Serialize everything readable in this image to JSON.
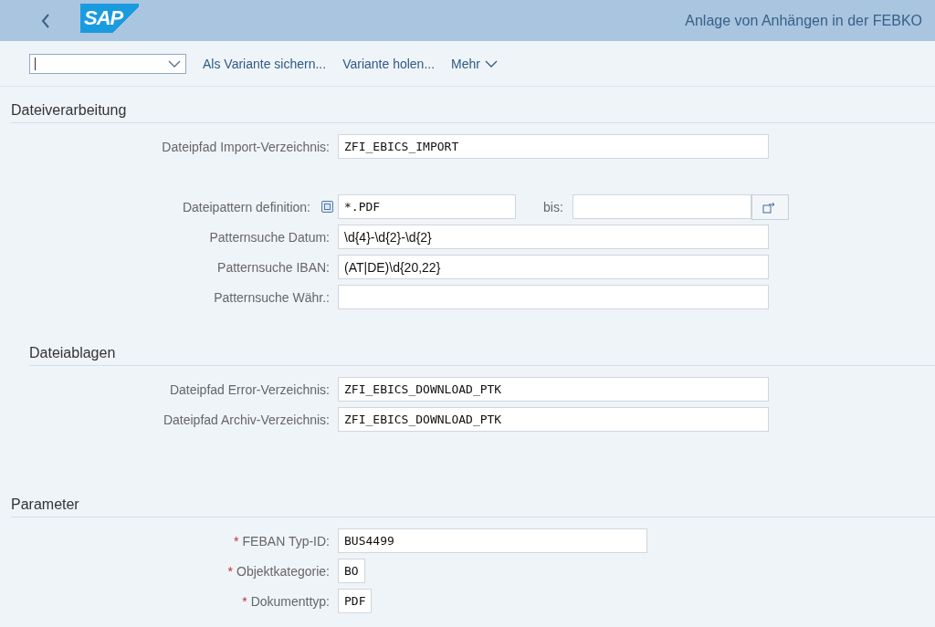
{
  "header": {
    "logo": "SAP",
    "title": "Anlage von Anhängen in der FEBKO"
  },
  "toolbar": {
    "actions": [
      {
        "label": "Als Variante sichern...",
        "kind": "link"
      },
      {
        "label": "Variante holen...",
        "kind": "link"
      },
      {
        "label": "Mehr",
        "kind": "menu"
      }
    ]
  },
  "sections": [
    {
      "title": "Dateiverarbeitung",
      "kind": "main",
      "groups": [
        [
          {
            "label": "Dateipfad Import-Verzeichnis:",
            "value": "ZFI_EBICS_IMPORT",
            "kind": "path"
          }
        ],
        [
          {
            "label": "Dateipattern definition:",
            "value": "*.PDF",
            "kind": "range",
            "to_label": "bis:"
          },
          {
            "label": "Patternsuche Datum:",
            "value": "\\d{4}-\\d{2}-\\d{2}",
            "kind": "pattern"
          },
          {
            "label": "Patternsuche IBAN:",
            "value": "(AT|DE)\\d{20,22}",
            "kind": "pattern"
          },
          {
            "label": "Patternsuche Währ.:",
            "kind": "pattern"
          }
        ]
      ]
    },
    {
      "title": "Dateiablagen",
      "kind": "sub",
      "groups": [
        [
          {
            "label": "Dateipfad Error-Verzeichnis:",
            "value": "ZFI_EBICS_DOWNLOAD_PTK",
            "kind": "path"
          },
          {
            "label": "Dateipfad Archiv-Verzeichnis:",
            "value": "ZFI_EBICS_DOWNLOAD_PTK",
            "kind": "path"
          }
        ]
      ]
    },
    {
      "title": "Parameter",
      "kind": "main",
      "groups": [
        [
          {
            "required_mark": "*",
            "label": "FEBAN Typ-ID:",
            "value": "BUS4499",
            "kind": "id"
          },
          {
            "required_mark": "*",
            "label": "Objektkategorie:",
            "value": "BO",
            "kind": "code"
          },
          {
            "required_mark": "*",
            "label": "Dokumenttyp:",
            "value": "PDF",
            "kind": "code"
          }
        ]
      ]
    }
  ]
}
